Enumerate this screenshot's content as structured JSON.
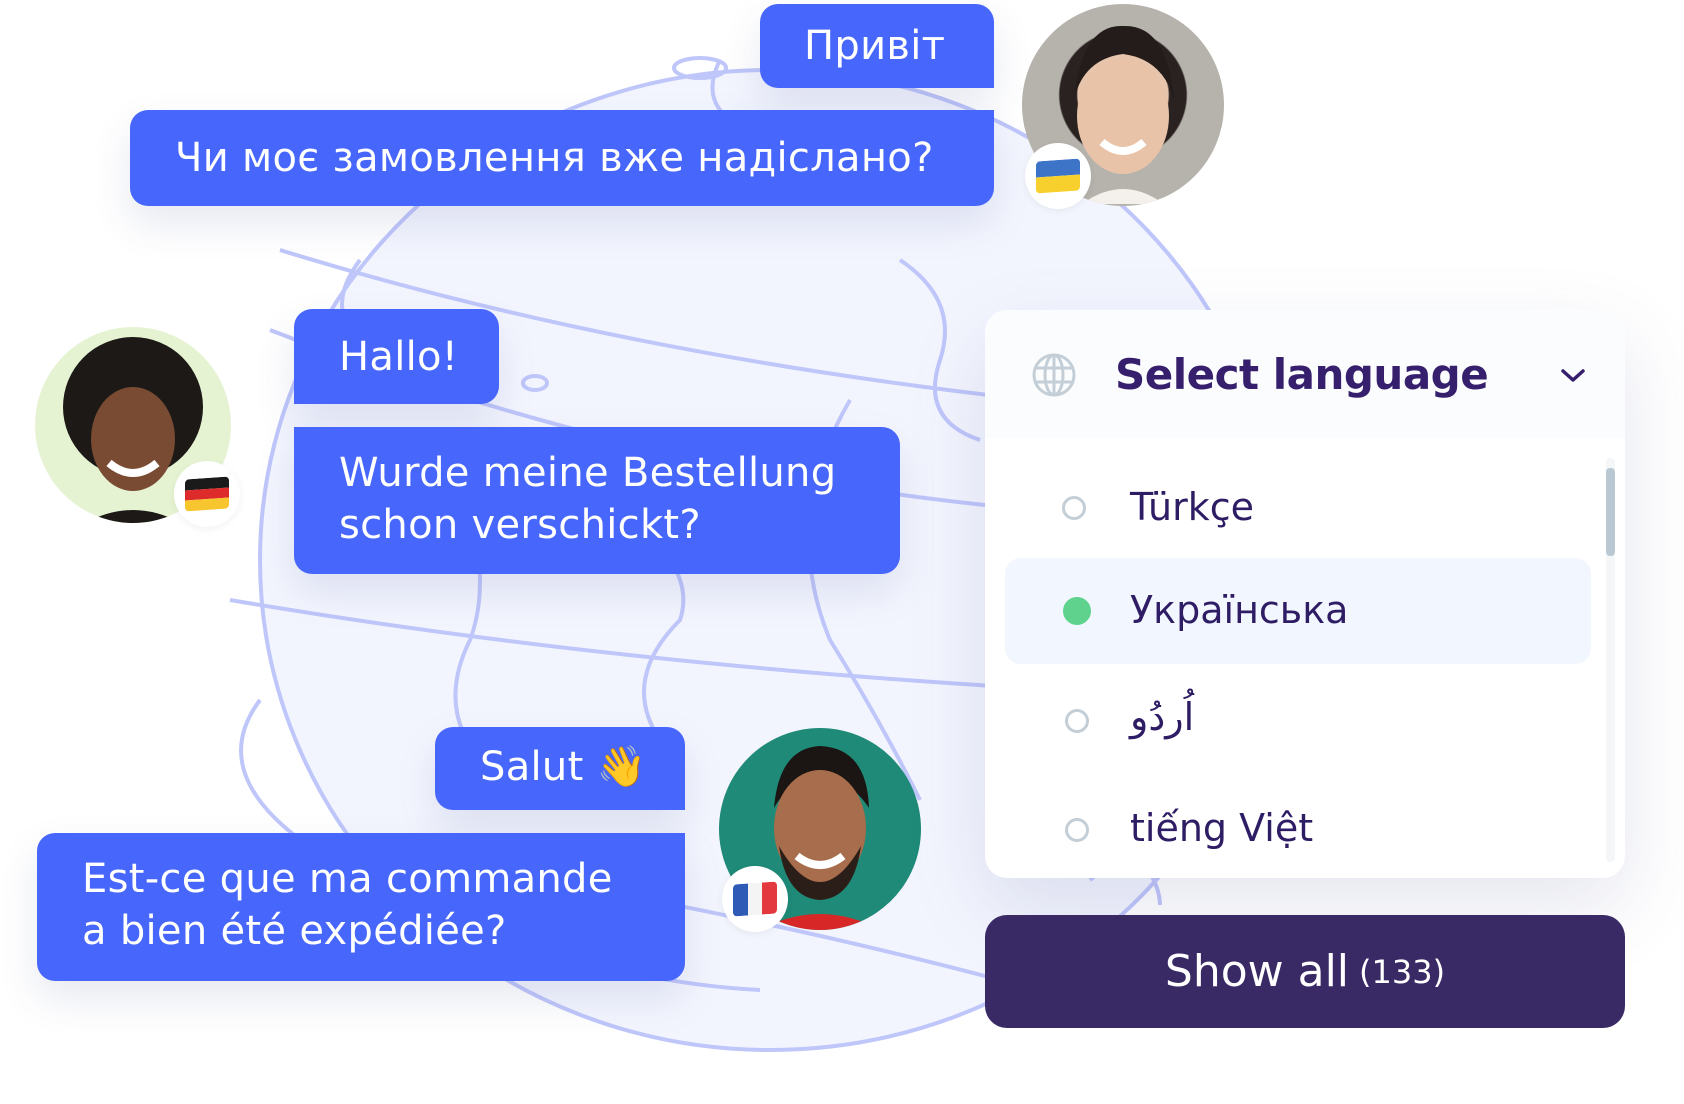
{
  "colors": {
    "bubble": "#4766fb",
    "panel_text": "#36206e",
    "selected_dot": "#5fd38d",
    "button_bg": "#392a66",
    "globe_stroke": "#bfc6fa",
    "globe_fill": "#f3f5fe"
  },
  "conversations": [
    {
      "language": "Ukrainian",
      "flag_icon": "ukraine-flag-icon",
      "messages": [
        "Привіт",
        "Чи моє замовлення вже надіслано?"
      ]
    },
    {
      "language": "German",
      "flag_icon": "germany-flag-icon",
      "messages": [
        "Hallo!",
        "Wurde meine Bestellung",
        "schon verschickt?"
      ]
    },
    {
      "language": "French",
      "flag_icon": "france-flag-icon",
      "messages": [
        "Salut 👋",
        "Est-ce que ma commande",
        "a bien été expédiée?"
      ]
    }
  ],
  "language_selector": {
    "icon": "globe-icon",
    "title": "Select language",
    "chevron": "chevron-down-icon",
    "options": [
      {
        "label": "Türkçe",
        "selected": false
      },
      {
        "label": "Українська",
        "selected": true
      },
      {
        "label": "اُردُو",
        "selected": false
      },
      {
        "label": "tiếng Việt",
        "selected": false
      }
    ]
  },
  "show_all": {
    "label": "Show all",
    "count": "(133)"
  }
}
